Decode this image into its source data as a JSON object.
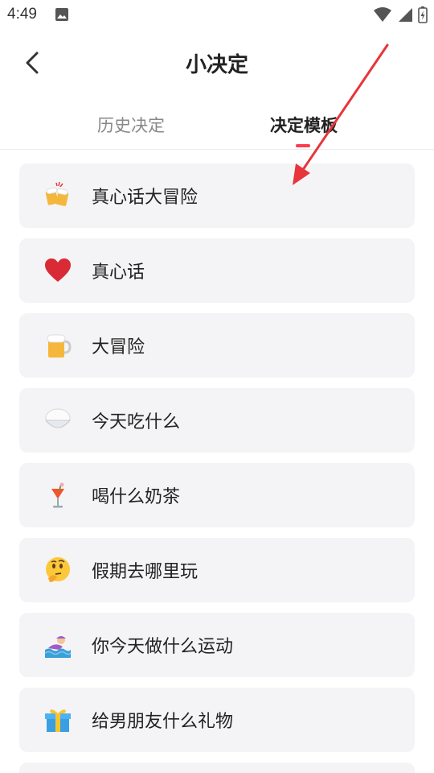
{
  "status_bar": {
    "time": "4:49"
  },
  "header": {
    "title": "小决定"
  },
  "tabs": [
    {
      "label": "历史决定",
      "selected": false
    },
    {
      "label": "决定模板",
      "selected": true
    }
  ],
  "templates": [
    {
      "label": "真心话大冒险",
      "icon": "beer-cheers-icon"
    },
    {
      "label": "真心话",
      "icon": "red-heart-icon"
    },
    {
      "label": "大冒险",
      "icon": "beer-mug-icon"
    },
    {
      "label": "今天吃什么",
      "icon": "rice-bowl-icon"
    },
    {
      "label": "喝什么奶茶",
      "icon": "tropical-drink-icon"
    },
    {
      "label": "假期去哪里玩",
      "icon": "thinking-face-icon"
    },
    {
      "label": "你今天做什么运动",
      "icon": "swimmer-icon"
    },
    {
      "label": "给男朋友什么礼物",
      "icon": "gift-icon"
    }
  ],
  "colors": {
    "accent": "#ff3b4e",
    "card_bg": "#f4f4f6",
    "annotation_arrow": "#e8343b"
  }
}
